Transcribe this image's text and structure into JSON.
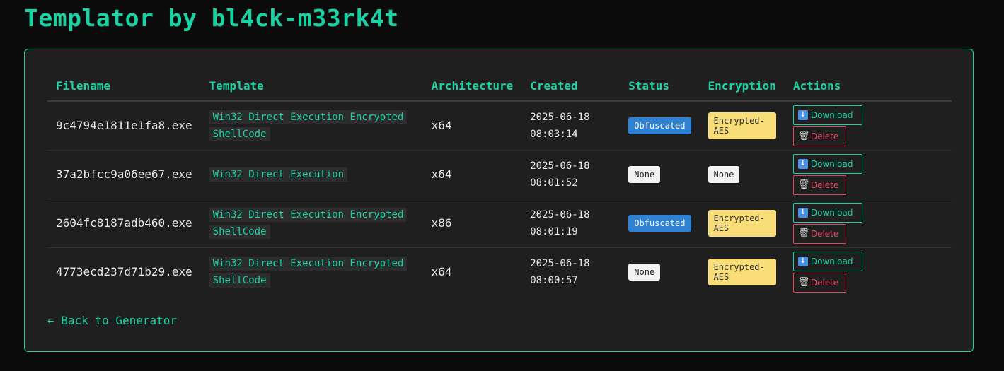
{
  "app": {
    "title": "Templator by bl4ck-m33rk4t"
  },
  "table": {
    "headers": [
      "Filename",
      "Template",
      "Architecture",
      "Created",
      "Status",
      "Encryption",
      "Actions"
    ],
    "rows": [
      {
        "filename": "9c4794e1811e1fa8.exe",
        "template": "Win32 Direct Execution Encrypted ShellCode",
        "arch": "x64",
        "created": "2025-06-18\n08:03:14",
        "status": "Obfuscated",
        "encryption": "Encrypted-AES"
      },
      {
        "filename": "37a2bfcc9a06ee67.exe",
        "template": "Win32 Direct Execution",
        "arch": "x64",
        "created": "2025-06-18\n08:01:52",
        "status": "None",
        "encryption": "None"
      },
      {
        "filename": "2604fc8187adb460.exe",
        "template": "Win32 Direct Execution Encrypted ShellCode",
        "arch": "x86",
        "created": "2025-06-18\n08:01:19",
        "status": "Obfuscated",
        "encryption": "Encrypted-AES"
      },
      {
        "filename": "4773ecd237d71b29.exe",
        "template": "Win32 Direct Execution Encrypted ShellCode",
        "arch": "x64",
        "created": "2025-06-18\n08:00:57",
        "status": "None",
        "encryption": "Encrypted-AES"
      }
    ]
  },
  "actions": {
    "download_label": "Download",
    "delete_label": "Delete"
  },
  "icons": {
    "download": "download-icon",
    "delete": "trash-icon"
  },
  "nav": {
    "back_label": "← Back to Generator"
  },
  "colors": {
    "accent": "#19d3a4",
    "danger": "#e0455f",
    "obfuscated": "#2f81d3",
    "aes": "#f8dd78"
  }
}
